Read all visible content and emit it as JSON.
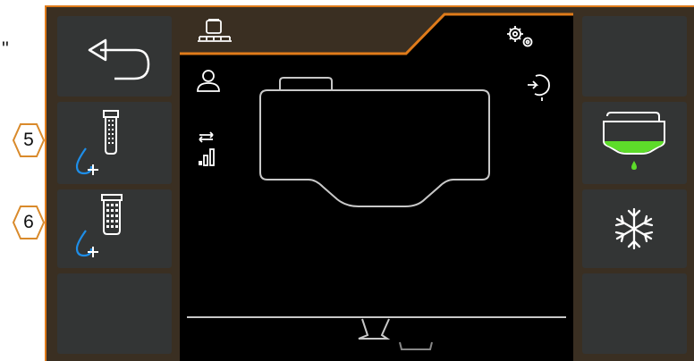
{
  "annotation": {
    "quote_char": "\"",
    "callouts": [
      "5",
      "6"
    ]
  },
  "left_panel": {
    "buttons": [
      {
        "name": "back-button",
        "icon": "back-arrow-icon"
      },
      {
        "name": "fill-button-5",
        "icon": "water-fill-icon"
      },
      {
        "name": "fill-button-6",
        "icon": "water-fill-grid-icon"
      },
      {
        "name": "empty-left-button",
        "icon": ""
      }
    ]
  },
  "center": {
    "tab_icon": "sprayer-icon",
    "settings_icon": "gears-icon",
    "operator_icon": "user-icon",
    "ecu_icon": "ecu-icon",
    "signal_icon": "signal-bars-icon",
    "tank_icon": "tank-outline-icon",
    "drain_icon": "drain-icon"
  },
  "right_panel": {
    "buttons": [
      {
        "name": "empty-right-top-button",
        "icon": ""
      },
      {
        "name": "tank-level-button",
        "icon": "tank-green-level-icon"
      },
      {
        "name": "frost-button",
        "icon": "snowflake-icon"
      },
      {
        "name": "empty-right-bottom-button",
        "icon": ""
      }
    ]
  },
  "colors": {
    "accent": "#e07b1a",
    "button_bg": "#333535",
    "icon_blue": "#1e8ee8",
    "level_green": "#5ddc2a"
  }
}
